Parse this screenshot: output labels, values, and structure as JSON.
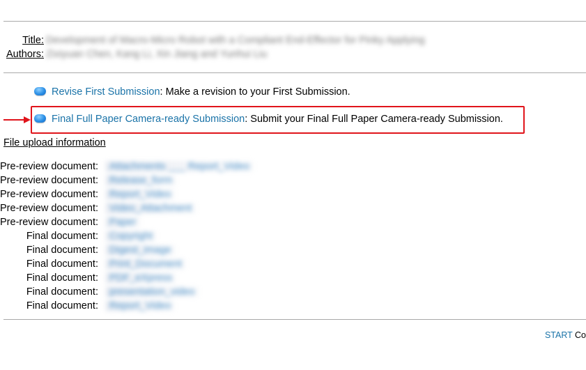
{
  "paper": {
    "title_label": "Title:",
    "title_value": "Development of Macro-Micro Robot with a Compliant End-Effector for Pinky Applying",
    "authors_label": "Authors:",
    "authors_value": "Zixiyuan Chen, Kang Li, Xin Jiang and Yunhui Liu"
  },
  "actions": [
    {
      "link": "Revise First Submission",
      "description": ": Make a revision to your First Submission."
    },
    {
      "link": "Final Full Paper Camera-ready Submission",
      "description": ": Submit your Final Full Paper Camera-ready Submission."
    }
  ],
  "annotation": {
    "highlight_color": "#e0141b",
    "pointer_icon": "red-arrow-icon"
  },
  "file_section": {
    "title": "File upload information",
    "rows": [
      {
        "label": "Pre-review document:",
        "file": "Attachments ___ Report_Video"
      },
      {
        "label": "Pre-review document:",
        "file": "Release_form"
      },
      {
        "label": "Pre-review document:",
        "file": "Report_Video"
      },
      {
        "label": "Pre-review document:",
        "file": "Video_Attachment"
      },
      {
        "label": "Pre-review document:",
        "file": "Paper"
      },
      {
        "label": "Final document:",
        "file": "Copyright"
      },
      {
        "label": "Final document:",
        "file": "Digest_image"
      },
      {
        "label": "Final document:",
        "file": "Print_Document"
      },
      {
        "label": "Final document:",
        "file": "PDF_eXpress"
      },
      {
        "label": "Final document:",
        "file": "presentation_video"
      },
      {
        "label": "Final document:",
        "file": "Report_Video"
      }
    ]
  },
  "footer": {
    "link": "START",
    "text": " Co"
  },
  "colors": {
    "link": "#1a73a8",
    "rule": "#a9a9a9"
  }
}
